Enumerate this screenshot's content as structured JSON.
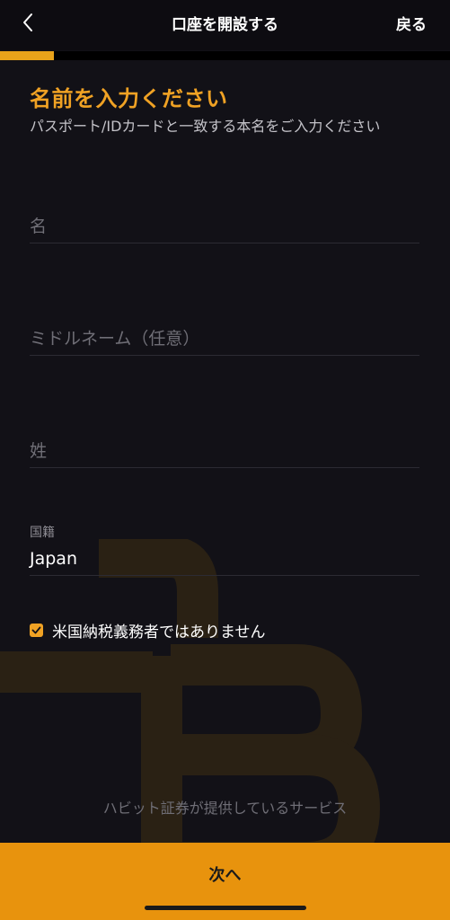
{
  "nav": {
    "title": "口座を開設する",
    "return_label": "戻る"
  },
  "progress": {
    "fraction": 0.12
  },
  "heading": "名前を入力ください",
  "subheading": "パスポート/IDカードと一致する本名をご入力ください",
  "fields": {
    "first_name": {
      "placeholder": "名",
      "value": ""
    },
    "middle_name": {
      "placeholder": "ミドルネーム（任意）",
      "value": ""
    },
    "last_name": {
      "placeholder": "姓",
      "value": ""
    }
  },
  "nationality": {
    "label": "国籍",
    "value": "Japan"
  },
  "checkbox": {
    "label": "米国納税義務者ではありません",
    "checked": true
  },
  "footer_note": "ハビット証券が提供しているサービス",
  "next_button_label": "次へ",
  "colors": {
    "accent": "#f0a224",
    "button": "#e8930d",
    "background": "#121117"
  }
}
